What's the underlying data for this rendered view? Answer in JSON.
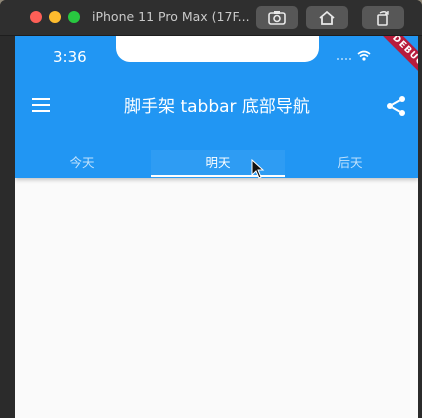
{
  "window": {
    "title": "iPhone 11 Pro Max (17F..."
  },
  "status_bar": {
    "time": "3:36",
    "debug_label": "DEBUG"
  },
  "app_bar": {
    "title": "脚手架 tabbar 底部导航",
    "menu_icon": "menu-icon",
    "share_icon": "share-icon",
    "color": "#2196f3"
  },
  "tabs": [
    {
      "label": "今天"
    },
    {
      "label": "明天"
    },
    {
      "label": "后天"
    }
  ],
  "active_tab": "明天"
}
